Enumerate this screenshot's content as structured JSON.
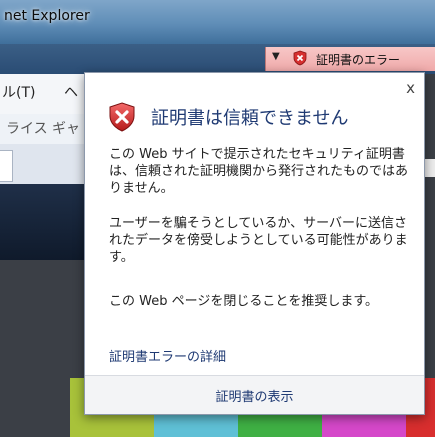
{
  "window": {
    "title": "net Explorer"
  },
  "address_bar": {
    "cert_error_label": "証明書のエラー",
    "chevron_icon": "chevron-down-icon",
    "shield_icon": "shield-x-icon",
    "accent_color": "#f0aaaa"
  },
  "menu": {
    "items": [
      "ル(T)",
      "ヘ"
    ]
  },
  "favorites": {
    "label": "ライス ギャ"
  },
  "popup": {
    "close_label": "x",
    "heading": "証明書は信頼できません",
    "para1": "この Web サイトで提示されたセキュリティ証明書は、信頼された証明機関から発行されたものではありません。",
    "para2": "ユーザーを騙そうとしているか、サーバーに送信されたデータを傍受しようとしている可能性があります。",
    "para3": "この Web ページを閉じることを推奨します。",
    "details_link": "証明書エラーの詳細",
    "view_cert_button": "証明書の表示",
    "heading_color": "#1f3a73"
  }
}
